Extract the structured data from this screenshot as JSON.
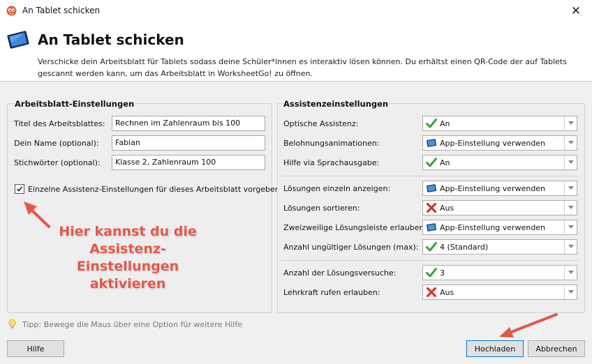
{
  "window": {
    "title": "An Tablet schicken",
    "close_glyph": "✕"
  },
  "header": {
    "title": "An Tablet schicken",
    "description": "Verschicke dein Arbeitsblatt für Tablets sodass deine Schüler*innen es interaktiv lösen können. Du erhältst einen QR-Code der auf Tablets gescannt werden kann, um das Arbeitsblatt in WorksheetGo! zu öffnen."
  },
  "worksheet_settings": {
    "title": "Arbeitsblatt-Einstellungen",
    "fields": [
      {
        "label": "Titel des Arbeitsblattes:",
        "value": "Rechnen im Zahlenraum bis 100"
      },
      {
        "label": "Dein Name (optional):",
        "value": "Fabian"
      },
      {
        "label": "Stichwörter (optional):",
        "value": "Klasse 2, Zahlenraum 100"
      }
    ],
    "custom_assist_checkbox": {
      "label": "Einzelne Assistenz-Einstellungen für dieses Arbeitsblatt vorgeben",
      "checked": true
    }
  },
  "annotations": {
    "left_line1": "Hier kannst du die",
    "left_line2": "Assistenz-Einstellungen",
    "left_line3": "aktivieren",
    "color": "#e2574c"
  },
  "assist_settings": {
    "title": "Assistenzeinstellungen",
    "rows": [
      {
        "label": "Optische Assistenz:",
        "value": "An",
        "icon": "check-icon"
      },
      {
        "label": "Belohnungsanimationen:",
        "value": "App-Einstellung verwenden",
        "icon": "tablet-icon"
      },
      {
        "label": "Hilfe via Sprachausgabe:",
        "value": "An",
        "icon": "check-icon"
      },
      {
        "label": "Lösungen einzeln anzeigen:",
        "value": "App-Einstellung verwenden",
        "icon": "tablet-icon"
      },
      {
        "label": "Lösungen sortieren:",
        "value": "Aus",
        "icon": "cross-icon"
      },
      {
        "label": "Zweizweilige Lösungsleiste erlauben:",
        "value": "App-Einstellung verwenden",
        "icon": "tablet-icon"
      },
      {
        "label": "Anzahl ungültiger Lösungen (max):",
        "value": "4 (Standard)",
        "icon": "check-icon"
      },
      {
        "label": "Anzahl der Lösungsversuche:",
        "value": "3",
        "icon": "check-icon"
      },
      {
        "label": "Lehrkraft rufen erlauben:",
        "value": "Aus",
        "icon": "cross-icon"
      }
    ]
  },
  "tip": {
    "text": "Tipp: Bewege die Maus über eine Option für weitere Hilfe"
  },
  "buttons": {
    "help": "Hilfe",
    "upload": "Hochladen",
    "cancel": "Abbrechen"
  }
}
